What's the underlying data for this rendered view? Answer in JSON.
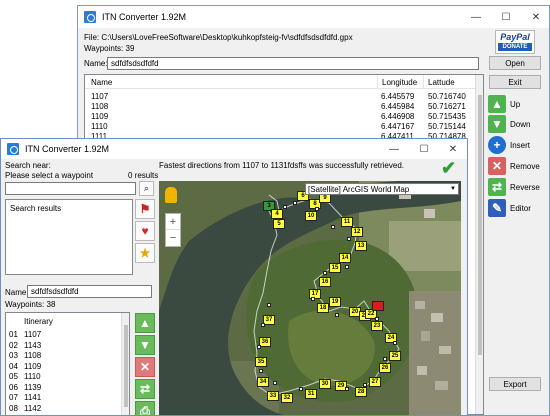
{
  "back_window": {
    "title": "ITN Converter 1.92M",
    "file_path": "File: C:\\Users\\LoveFreeSoftware\\Desktop\\kuhkopfsteig-fv\\sdfdfsdsdfdfd.gpx",
    "waypoints": "Waypoints: 39",
    "name_label": "Name:",
    "name_value": "sdfdfsdsdfdfd",
    "columns": {
      "name": "Name",
      "longitude": "Longitude",
      "latitude": "Lattude"
    },
    "rows": [
      {
        "name": "1107",
        "lon": "6.445579",
        "lat": "50.716740"
      },
      {
        "name": "1108",
        "lon": "6.445984",
        "lat": "50.716271"
      },
      {
        "name": "1109",
        "lon": "6.446908",
        "lat": "50.715435"
      },
      {
        "name": "1110",
        "lon": "6.447167",
        "lat": "50.715144"
      },
      {
        "name": "1111",
        "lon": "6.447411",
        "lat": "50.714878"
      }
    ],
    "paypal": {
      "line1": "PayPal",
      "line2": "DONATE"
    },
    "buttons": {
      "open": "Open",
      "exit": "Exit",
      "up": "Up",
      "down": "Down",
      "insert": "Insert",
      "remove": "Remove",
      "reverse": "Reverse",
      "editor": "Editor",
      "export": "Export"
    }
  },
  "front_window": {
    "title": "ITN Converter 1.92M",
    "search_near": "Search near:",
    "select_waypoint": "Please select a waypoint",
    "results_count": "0 results",
    "search_results": "Search results",
    "status_message": "Fastest directions from 1107 to 1131fdsffs was successfully retrieved.",
    "map_source": "[Satellite] ArcGIS World Map",
    "name_label": "Name:",
    "name_value": "sdfdfsdsdfdfd",
    "waypoints": "Waypoints: 38",
    "itinerary_header": "Itinerary",
    "itinerary": [
      {
        "idx": "01",
        "name": "1107"
      },
      {
        "idx": "02",
        "name": "1143"
      },
      {
        "idx": "03",
        "name": "1108"
      },
      {
        "idx": "04",
        "name": "1109"
      },
      {
        "idx": "05",
        "name": "1110"
      },
      {
        "idx": "06",
        "name": "1139"
      },
      {
        "idx": "07",
        "name": "1141"
      },
      {
        "idx": "08",
        "name": "1142"
      }
    ],
    "zoom_in": "+",
    "zoom_out": "−",
    "markers": [
      "3",
      "4",
      "5",
      "6",
      "8",
      "9",
      "10",
      "11",
      "12",
      "13",
      "14",
      "15",
      "16",
      "17",
      "18",
      "19",
      "20",
      "21",
      "22",
      "23",
      "24",
      "25",
      "26",
      "27",
      "28",
      "29",
      "30",
      "31",
      "32",
      "33",
      "34",
      "35",
      "36",
      "37"
    ]
  },
  "colors": {
    "accent": "#2a7dd6",
    "marker": "#ffff3a",
    "marker_end": "#e01a1a",
    "route_ok": "#2f9e3a"
  }
}
